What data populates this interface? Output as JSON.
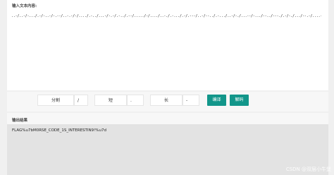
{
  "input": {
    "label": "输入文本内容:",
    "value": "..-/..-/-.../.-/-..-/-.--/..-.-/-/..../.-../...-/-.-/.-../.--/...../-/..../..-./.-.../.-/.---/..-/--../.-.../..-/-./...--/-.../--../---./.-/-./.../--.-/....-/.-/----/..-/.--/--./..-/-.--/..."
  },
  "controls": {
    "separator_label": "分割",
    "separator_value": "/",
    "short_label": "短",
    "short_value": ".",
    "long_label": "长",
    "long_value": "-",
    "encode_button": "编译",
    "decode_button": "解码"
  },
  "output": {
    "label": "输出结果",
    "value": "FLAG%u7bM0RSE_CODE_1S_INTERESTIN9!%u7d"
  },
  "watermark": "CSDN @双层小牛堡"
}
